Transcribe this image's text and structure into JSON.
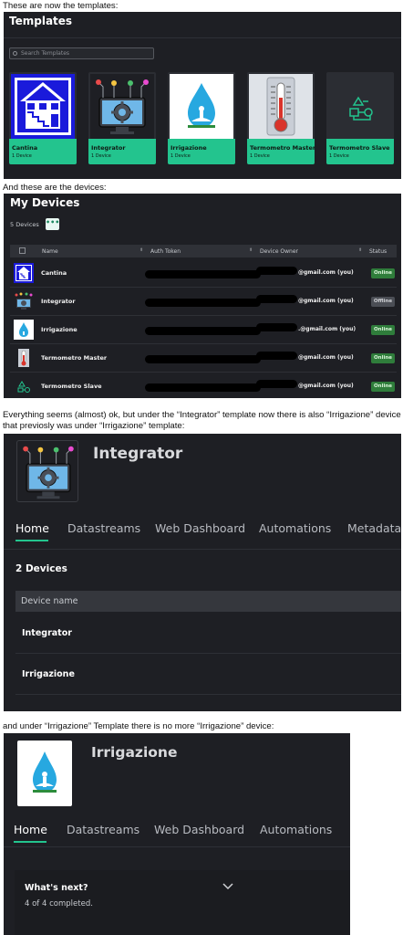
{
  "captions": {
    "c1": "These are now the templates:",
    "c2": "And these are the devices:",
    "c3a": "Everything seems (almost) ok, but under the “Integrator” template now there is also “Irrigazione” device",
    "c3b": "that previosly was under “Irrigazione” template:",
    "c4": "and under “Irrigazione” Template there is no more “Irrigazione” device:"
  },
  "templates_panel": {
    "title": "Templates",
    "search_placeholder": "Search Templates",
    "cards": [
      {
        "name": "Cantina",
        "count": "1 Device"
      },
      {
        "name": "Integrator",
        "count": "1 Device"
      },
      {
        "name": "Irrigazione",
        "count": "1 Device"
      },
      {
        "name": "Termometro Master",
        "count": "1 Device"
      },
      {
        "name": "Termometro Slave",
        "count": "1 Device"
      }
    ]
  },
  "devices_panel": {
    "title": "My Devices",
    "count": "5 Devices",
    "more": "•••",
    "columns": {
      "name": "Name",
      "token": "Auth Token",
      "owner": "Device Owner",
      "status": "Status"
    },
    "rows": [
      {
        "name": "Cantina",
        "owner": "@gmail.com (you)",
        "status": "Online"
      },
      {
        "name": "Integrator",
        "owner": "@gmail.com (you)",
        "status": "Offline"
      },
      {
        "name": "Irrigazione",
        "owner": ".@gmail.com (you)",
        "status": "Online"
      },
      {
        "name": "Termometro Master",
        "owner": "@gmail.com (you)",
        "status": "Online"
      },
      {
        "name": "Termometro Slave",
        "owner": "@gmail.com (you)",
        "status": "Online"
      }
    ]
  },
  "integrator_panel": {
    "title": "Integrator",
    "tabs": [
      "Home",
      "Datastreams",
      "Web Dashboard",
      "Automations",
      "Metadata"
    ],
    "device_count": "2 Devices",
    "column": "Device name",
    "rows": [
      "Integrator",
      "Irrigazione"
    ]
  },
  "irrigazione_panel": {
    "title": "Irrigazione",
    "tabs": [
      "Home",
      "Datastreams",
      "Web Dashboard",
      "Automations"
    ],
    "whats_next": "What's next?",
    "completed": "4 of 4 completed."
  },
  "colors": {
    "accent": "#23c48e",
    "panel_bg": "#1e1f24",
    "online": "#2f7d3b",
    "offline": "#4b4e55"
  }
}
